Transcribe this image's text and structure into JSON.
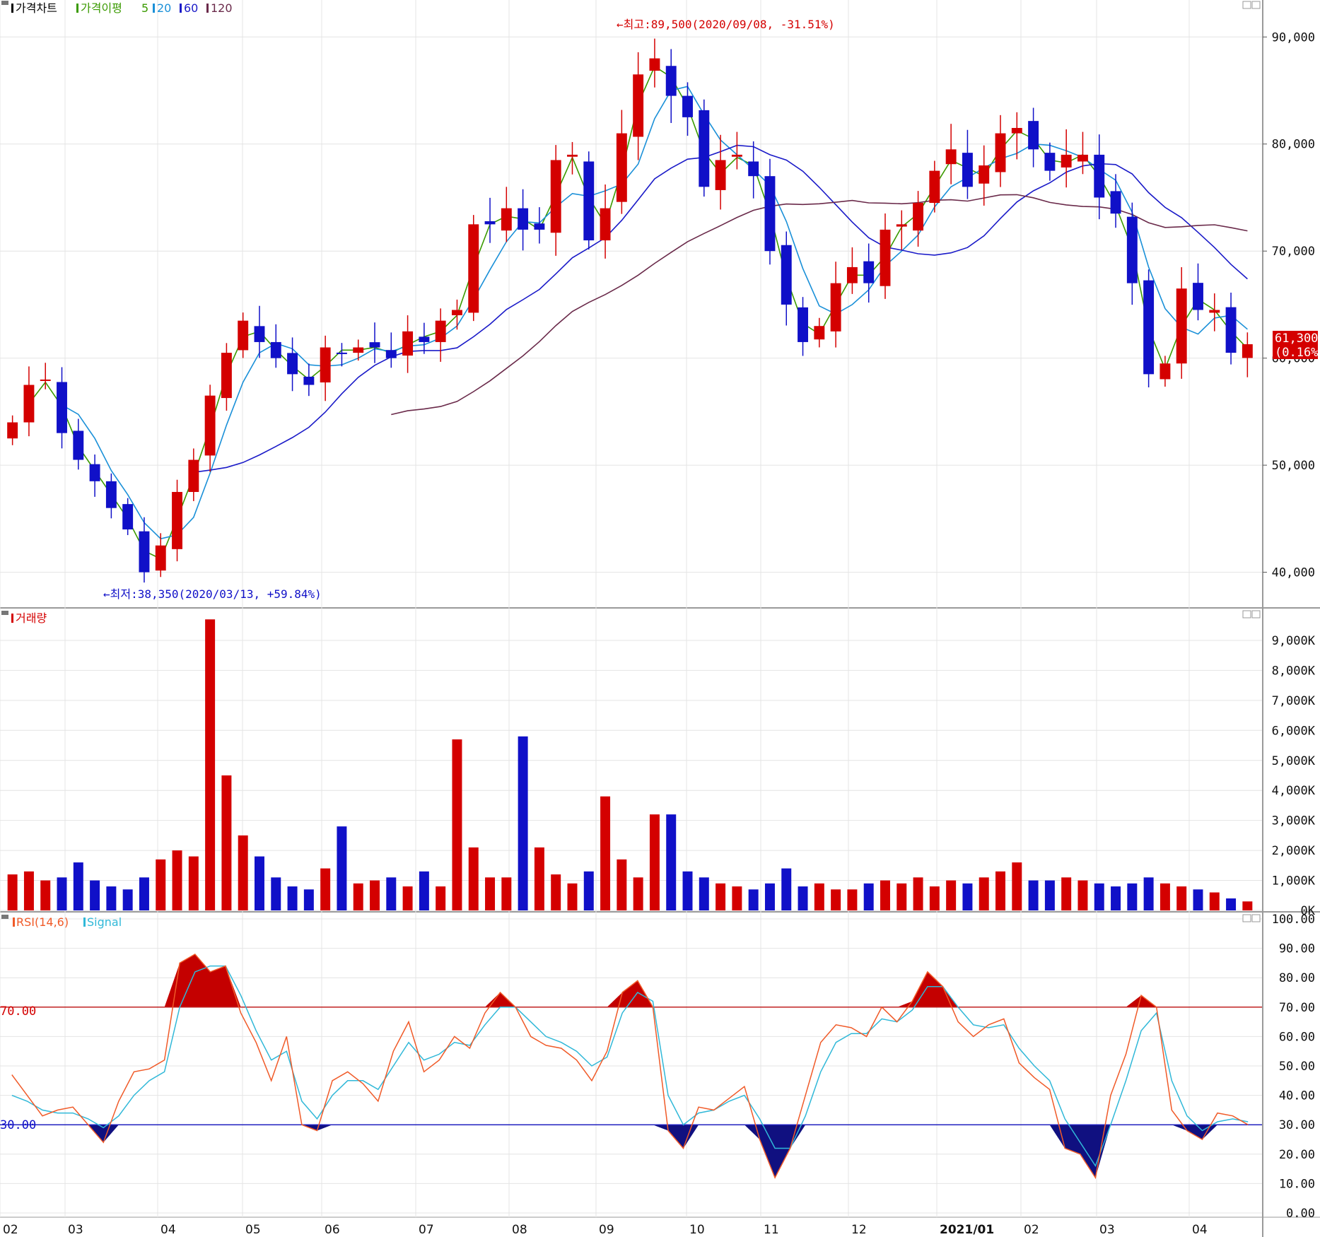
{
  "price_panel": {
    "legend": [
      {
        "label": "가격차트",
        "color": "#000000"
      },
      {
        "label": "가격이평",
        "color": "#3a9a00"
      },
      {
        "label": "5",
        "color": "#3a9a00"
      },
      {
        "label": "20",
        "color": "#1a90d8"
      },
      {
        "label": "60",
        "color": "#1a1ac8"
      },
      {
        "label": "120",
        "color": "#6a2a4a"
      }
    ],
    "high_annotation": "←최고:89,500(2020/09/08, -31.51%)",
    "low_annotation": "←최저:38,350(2020/03/13, +59.84%)",
    "last_price": "61,300",
    "last_change": "(0.16%)"
  },
  "volume_panel": {
    "legend": "거래량"
  },
  "rsi_panel": {
    "legend_rsi": "RSI(14,6)",
    "legend_signal": "Signal",
    "level_high": "70.00",
    "level_low": "30.00"
  },
  "colors": {
    "up": "#d40000",
    "down": "#1010c8",
    "ma5": "#3a9a00",
    "ma20": "#1a90d8",
    "ma60": "#1a1ac8",
    "ma120": "#6a2a4a",
    "rsi": "#f05a28",
    "signal": "#30b8d8",
    "grid": "#e4e4e4",
    "panel_border": "#9a9a9a"
  },
  "chart_data": [
    {
      "type": "candlestick",
      "title": "가격차트",
      "x": [
        "02",
        "03",
        "04",
        "05",
        "06",
        "07",
        "08",
        "09",
        "10",
        "11",
        "12",
        "2021/01",
        "02",
        "03",
        "04"
      ],
      "y_ticks": [
        "40,000",
        "50,000",
        "60,000",
        "70,000",
        "80,000",
        "90,000"
      ],
      "ylim": [
        37000,
        92000
      ],
      "period": "weekly",
      "series": [
        {
          "name": "close",
          "values": [
            54000,
            57500,
            58000,
            53000,
            50500,
            48500,
            46000,
            44000,
            40000,
            42500,
            47500,
            50500,
            56500,
            60500,
            63500,
            61500,
            60000,
            58500,
            57500,
            61000,
            60500,
            61000,
            61000,
            60000,
            62500,
            61500,
            63500,
            64500,
            72500,
            72500,
            74000,
            72000,
            72000,
            78500,
            79000,
            71000,
            74000,
            81000,
            86500,
            88000,
            84500,
            82500,
            76000,
            78500,
            79000,
            77000,
            70000,
            65000,
            61500,
            63000,
            67000,
            68500,
            67000,
            72000,
            72500,
            74500,
            77500,
            79500,
            76000,
            78000,
            81000,
            81500,
            79500,
            77500,
            79000,
            79000,
            75000,
            73500,
            67000,
            58500,
            59500,
            66500,
            64500,
            64500,
            60500,
            61300
          ]
        }
      ]
    },
    {
      "type": "bar",
      "title": "거래량",
      "y_ticks": [
        "0K",
        "1,000K",
        "2,000K",
        "3,000K",
        "4,000K",
        "5,000K",
        "6,000K",
        "7,000K",
        "8,000K",
        "9,000K"
      ],
      "ylim": [
        0,
        9800
      ],
      "unit": "K",
      "values": [
        1200,
        1300,
        1000,
        1100,
        1600,
        1000,
        800,
        700,
        1100,
        1700,
        2000,
        1800,
        9700,
        4500,
        2500,
        1800,
        1100,
        800,
        700,
        1400,
        2800,
        900,
        1000,
        1100,
        800,
        1300,
        800,
        5700,
        2100,
        1100,
        1100,
        5800,
        2100,
        1200,
        900,
        1300,
        3800,
        1700,
        1100,
        3200,
        3200,
        1300,
        1100,
        900,
        800,
        700,
        900,
        1400,
        800,
        900,
        700,
        700,
        900,
        1000,
        900,
        1100,
        800,
        1000,
        900,
        1100,
        1300,
        1600,
        1000,
        1000,
        1100,
        1000,
        900,
        800,
        900,
        1100,
        900,
        800,
        700,
        600,
        400,
        300
      ]
    },
    {
      "type": "line",
      "title": "RSI(14,6)",
      "y_ticks": [
        "0.00",
        "10.00",
        "20.00",
        "30.00",
        "40.00",
        "50.00",
        "60.00",
        "70.00",
        "80.00",
        "90.00",
        "100.00"
      ],
      "ylim": [
        0,
        100
      ],
      "reference_lines": [
        70,
        30
      ],
      "series": [
        {
          "name": "RSI(14,6)",
          "values": [
            47,
            40,
            33,
            35,
            36,
            30,
            24,
            38,
            48,
            49,
            52,
            85,
            88,
            82,
            84,
            68,
            58,
            45,
            60,
            30,
            28,
            45,
            48,
            44,
            38,
            55,
            65,
            48,
            52,
            60,
            56,
            68,
            75,
            70,
            60,
            57,
            56,
            52,
            45,
            55,
            75,
            79,
            70,
            28,
            22,
            36,
            35,
            39,
            43,
            25,
            12,
            22,
            40,
            58,
            64,
            63,
            60,
            70,
            65,
            72,
            82,
            77,
            65,
            60,
            64,
            66,
            51,
            46,
            42,
            22,
            20,
            12,
            40,
            54,
            74,
            70,
            35,
            28,
            25,
            34,
            33,
            30
          ]
        },
        {
          "name": "Signal",
          "values": [
            40,
            38,
            35,
            34,
            34,
            32,
            29,
            33,
            40,
            45,
            48,
            70,
            82,
            84,
            84,
            74,
            62,
            52,
            55,
            38,
            32,
            40,
            45,
            45,
            42,
            50,
            58,
            52,
            54,
            58,
            57,
            64,
            70,
            70,
            65,
            60,
            58,
            55,
            50,
            53,
            68,
            75,
            72,
            40,
            30,
            34,
            35,
            38,
            40,
            32,
            22,
            22,
            33,
            48,
            58,
            61,
            61,
            66,
            65,
            69,
            77,
            77,
            70,
            64,
            63,
            64,
            56,
            50,
            45,
            32,
            24,
            16,
            30,
            45,
            62,
            68,
            45,
            33,
            28,
            31,
            32,
            31
          ]
        }
      ]
    }
  ]
}
